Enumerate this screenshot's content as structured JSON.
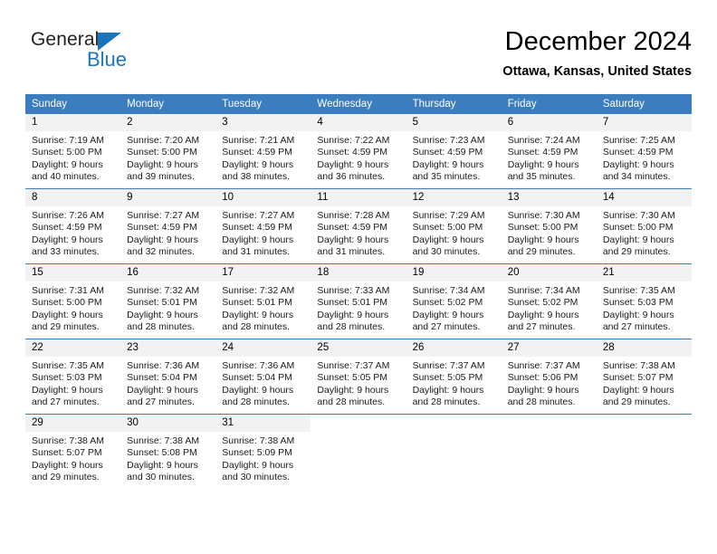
{
  "logo": {
    "primary_text": "General",
    "secondary_text": "Blue",
    "triangle_icon": "blue-triangle-icon",
    "primary_color": "#231f20",
    "secondary_color": "#1b75bb"
  },
  "header": {
    "title": "December 2024",
    "subtitle": "Ottawa, Kansas, United States"
  },
  "theme": {
    "header_bg": "#3c7dbf",
    "header_text": "#ffffff",
    "daynum_bg": "#f2f2f2",
    "grid_line": "#3c7dbf",
    "body_text": "#1a1a1a"
  },
  "calendar": {
    "weekday_headers": [
      "Sunday",
      "Monday",
      "Tuesday",
      "Wednesday",
      "Thursday",
      "Friday",
      "Saturday"
    ],
    "weeks": [
      [
        {
          "day": "1",
          "sunrise": "Sunrise: 7:19 AM",
          "sunset": "Sunset: 5:00 PM",
          "daylight_line1": "Daylight: 9 hours",
          "daylight_line2": "and 40 minutes."
        },
        {
          "day": "2",
          "sunrise": "Sunrise: 7:20 AM",
          "sunset": "Sunset: 5:00 PM",
          "daylight_line1": "Daylight: 9 hours",
          "daylight_line2": "and 39 minutes."
        },
        {
          "day": "3",
          "sunrise": "Sunrise: 7:21 AM",
          "sunset": "Sunset: 4:59 PM",
          "daylight_line1": "Daylight: 9 hours",
          "daylight_line2": "and 38 minutes."
        },
        {
          "day": "4",
          "sunrise": "Sunrise: 7:22 AM",
          "sunset": "Sunset: 4:59 PM",
          "daylight_line1": "Daylight: 9 hours",
          "daylight_line2": "and 36 minutes."
        },
        {
          "day": "5",
          "sunrise": "Sunrise: 7:23 AM",
          "sunset": "Sunset: 4:59 PM",
          "daylight_line1": "Daylight: 9 hours",
          "daylight_line2": "and 35 minutes."
        },
        {
          "day": "6",
          "sunrise": "Sunrise: 7:24 AM",
          "sunset": "Sunset: 4:59 PM",
          "daylight_line1": "Daylight: 9 hours",
          "daylight_line2": "and 35 minutes."
        },
        {
          "day": "7",
          "sunrise": "Sunrise: 7:25 AM",
          "sunset": "Sunset: 4:59 PM",
          "daylight_line1": "Daylight: 9 hours",
          "daylight_line2": "and 34 minutes."
        }
      ],
      [
        {
          "day": "8",
          "sunrise": "Sunrise: 7:26 AM",
          "sunset": "Sunset: 4:59 PM",
          "daylight_line1": "Daylight: 9 hours",
          "daylight_line2": "and 33 minutes."
        },
        {
          "day": "9",
          "sunrise": "Sunrise: 7:27 AM",
          "sunset": "Sunset: 4:59 PM",
          "daylight_line1": "Daylight: 9 hours",
          "daylight_line2": "and 32 minutes."
        },
        {
          "day": "10",
          "sunrise": "Sunrise: 7:27 AM",
          "sunset": "Sunset: 4:59 PM",
          "daylight_line1": "Daylight: 9 hours",
          "daylight_line2": "and 31 minutes."
        },
        {
          "day": "11",
          "sunrise": "Sunrise: 7:28 AM",
          "sunset": "Sunset: 4:59 PM",
          "daylight_line1": "Daylight: 9 hours",
          "daylight_line2": "and 31 minutes."
        },
        {
          "day": "12",
          "sunrise": "Sunrise: 7:29 AM",
          "sunset": "Sunset: 5:00 PM",
          "daylight_line1": "Daylight: 9 hours",
          "daylight_line2": "and 30 minutes."
        },
        {
          "day": "13",
          "sunrise": "Sunrise: 7:30 AM",
          "sunset": "Sunset: 5:00 PM",
          "daylight_line1": "Daylight: 9 hours",
          "daylight_line2": "and 29 minutes."
        },
        {
          "day": "14",
          "sunrise": "Sunrise: 7:30 AM",
          "sunset": "Sunset: 5:00 PM",
          "daylight_line1": "Daylight: 9 hours",
          "daylight_line2": "and 29 minutes."
        }
      ],
      [
        {
          "day": "15",
          "sunrise": "Sunrise: 7:31 AM",
          "sunset": "Sunset: 5:00 PM",
          "daylight_line1": "Daylight: 9 hours",
          "daylight_line2": "and 29 minutes."
        },
        {
          "day": "16",
          "sunrise": "Sunrise: 7:32 AM",
          "sunset": "Sunset: 5:01 PM",
          "daylight_line1": "Daylight: 9 hours",
          "daylight_line2": "and 28 minutes."
        },
        {
          "day": "17",
          "sunrise": "Sunrise: 7:32 AM",
          "sunset": "Sunset: 5:01 PM",
          "daylight_line1": "Daylight: 9 hours",
          "daylight_line2": "and 28 minutes."
        },
        {
          "day": "18",
          "sunrise": "Sunrise: 7:33 AM",
          "sunset": "Sunset: 5:01 PM",
          "daylight_line1": "Daylight: 9 hours",
          "daylight_line2": "and 28 minutes."
        },
        {
          "day": "19",
          "sunrise": "Sunrise: 7:34 AM",
          "sunset": "Sunset: 5:02 PM",
          "daylight_line1": "Daylight: 9 hours",
          "daylight_line2": "and 27 minutes."
        },
        {
          "day": "20",
          "sunrise": "Sunrise: 7:34 AM",
          "sunset": "Sunset: 5:02 PM",
          "daylight_line1": "Daylight: 9 hours",
          "daylight_line2": "and 27 minutes."
        },
        {
          "day": "21",
          "sunrise": "Sunrise: 7:35 AM",
          "sunset": "Sunset: 5:03 PM",
          "daylight_line1": "Daylight: 9 hours",
          "daylight_line2": "and 27 minutes."
        }
      ],
      [
        {
          "day": "22",
          "sunrise": "Sunrise: 7:35 AM",
          "sunset": "Sunset: 5:03 PM",
          "daylight_line1": "Daylight: 9 hours",
          "daylight_line2": "and 27 minutes."
        },
        {
          "day": "23",
          "sunrise": "Sunrise: 7:36 AM",
          "sunset": "Sunset: 5:04 PM",
          "daylight_line1": "Daylight: 9 hours",
          "daylight_line2": "and 27 minutes."
        },
        {
          "day": "24",
          "sunrise": "Sunrise: 7:36 AM",
          "sunset": "Sunset: 5:04 PM",
          "daylight_line1": "Daylight: 9 hours",
          "daylight_line2": "and 28 minutes."
        },
        {
          "day": "25",
          "sunrise": "Sunrise: 7:37 AM",
          "sunset": "Sunset: 5:05 PM",
          "daylight_line1": "Daylight: 9 hours",
          "daylight_line2": "and 28 minutes."
        },
        {
          "day": "26",
          "sunrise": "Sunrise: 7:37 AM",
          "sunset": "Sunset: 5:05 PM",
          "daylight_line1": "Daylight: 9 hours",
          "daylight_line2": "and 28 minutes."
        },
        {
          "day": "27",
          "sunrise": "Sunrise: 7:37 AM",
          "sunset": "Sunset: 5:06 PM",
          "daylight_line1": "Daylight: 9 hours",
          "daylight_line2": "and 28 minutes."
        },
        {
          "day": "28",
          "sunrise": "Sunrise: 7:38 AM",
          "sunset": "Sunset: 5:07 PM",
          "daylight_line1": "Daylight: 9 hours",
          "daylight_line2": "and 29 minutes."
        }
      ],
      [
        {
          "day": "29",
          "sunrise": "Sunrise: 7:38 AM",
          "sunset": "Sunset: 5:07 PM",
          "daylight_line1": "Daylight: 9 hours",
          "daylight_line2": "and 29 minutes."
        },
        {
          "day": "30",
          "sunrise": "Sunrise: 7:38 AM",
          "sunset": "Sunset: 5:08 PM",
          "daylight_line1": "Daylight: 9 hours",
          "daylight_line2": "and 30 minutes."
        },
        {
          "day": "31",
          "sunrise": "Sunrise: 7:38 AM",
          "sunset": "Sunset: 5:09 PM",
          "daylight_line1": "Daylight: 9 hours",
          "daylight_line2": "and 30 minutes."
        },
        {
          "day": "",
          "sunrise": "",
          "sunset": "",
          "daylight_line1": "",
          "daylight_line2": ""
        },
        {
          "day": "",
          "sunrise": "",
          "sunset": "",
          "daylight_line1": "",
          "daylight_line2": ""
        },
        {
          "day": "",
          "sunrise": "",
          "sunset": "",
          "daylight_line1": "",
          "daylight_line2": ""
        },
        {
          "day": "",
          "sunrise": "",
          "sunset": "",
          "daylight_line1": "",
          "daylight_line2": ""
        }
      ]
    ]
  }
}
